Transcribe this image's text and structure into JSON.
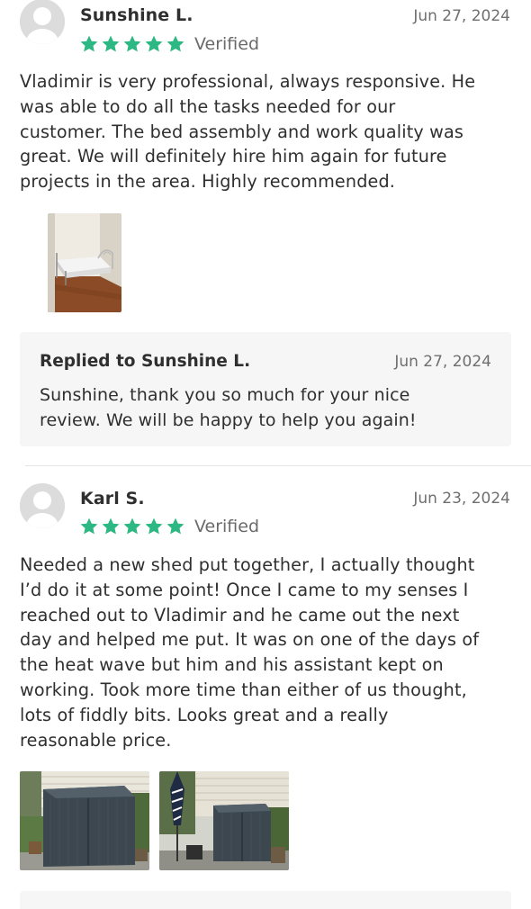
{
  "reviews": [
    {
      "reviewer": "Sunshine L.",
      "date": "Jun 27, 2024",
      "rating": 5,
      "verified_label": "Verified",
      "text_lines": [
        "Vladimir is very professional, always responsive. He",
        "was able to do all the tasks needed for our",
        "customer. The bed assembly and work quality was",
        "great. We will definitely hire him again for future",
        "projects in the area. Highly recommended."
      ],
      "reply": {
        "title": "Replied to Sunshine L.",
        "date": "Jun 27, 2024",
        "text_lines": [
          "Sunshine, thank you so much for your nice",
          "review. We will be happy to help you again!"
        ]
      }
    },
    {
      "reviewer": "Karl S.",
      "date": "Jun 23, 2024",
      "rating": 5,
      "verified_label": "Verified",
      "text_lines": [
        "Needed a new shed put together, I actually thought",
        "I’d do it at some point! Once I came to my senses I",
        "reached out to Vladimir and he came out the next",
        "day and helped me put. It was on one of the days of",
        "the heat wave but him and his assistant kept on",
        "working. Took more time than either of us thought,",
        "lots of fiddly bits. Looks great and a really",
        "reasonable price."
      ]
    }
  ],
  "colors": {
    "star": "#2db783",
    "reply_bg": "#f6f6f6",
    "text": "#2f2f2f",
    "muted": "#6f6f6f"
  },
  "icons": {
    "star": "star-icon",
    "avatar": "user-avatar-icon"
  }
}
